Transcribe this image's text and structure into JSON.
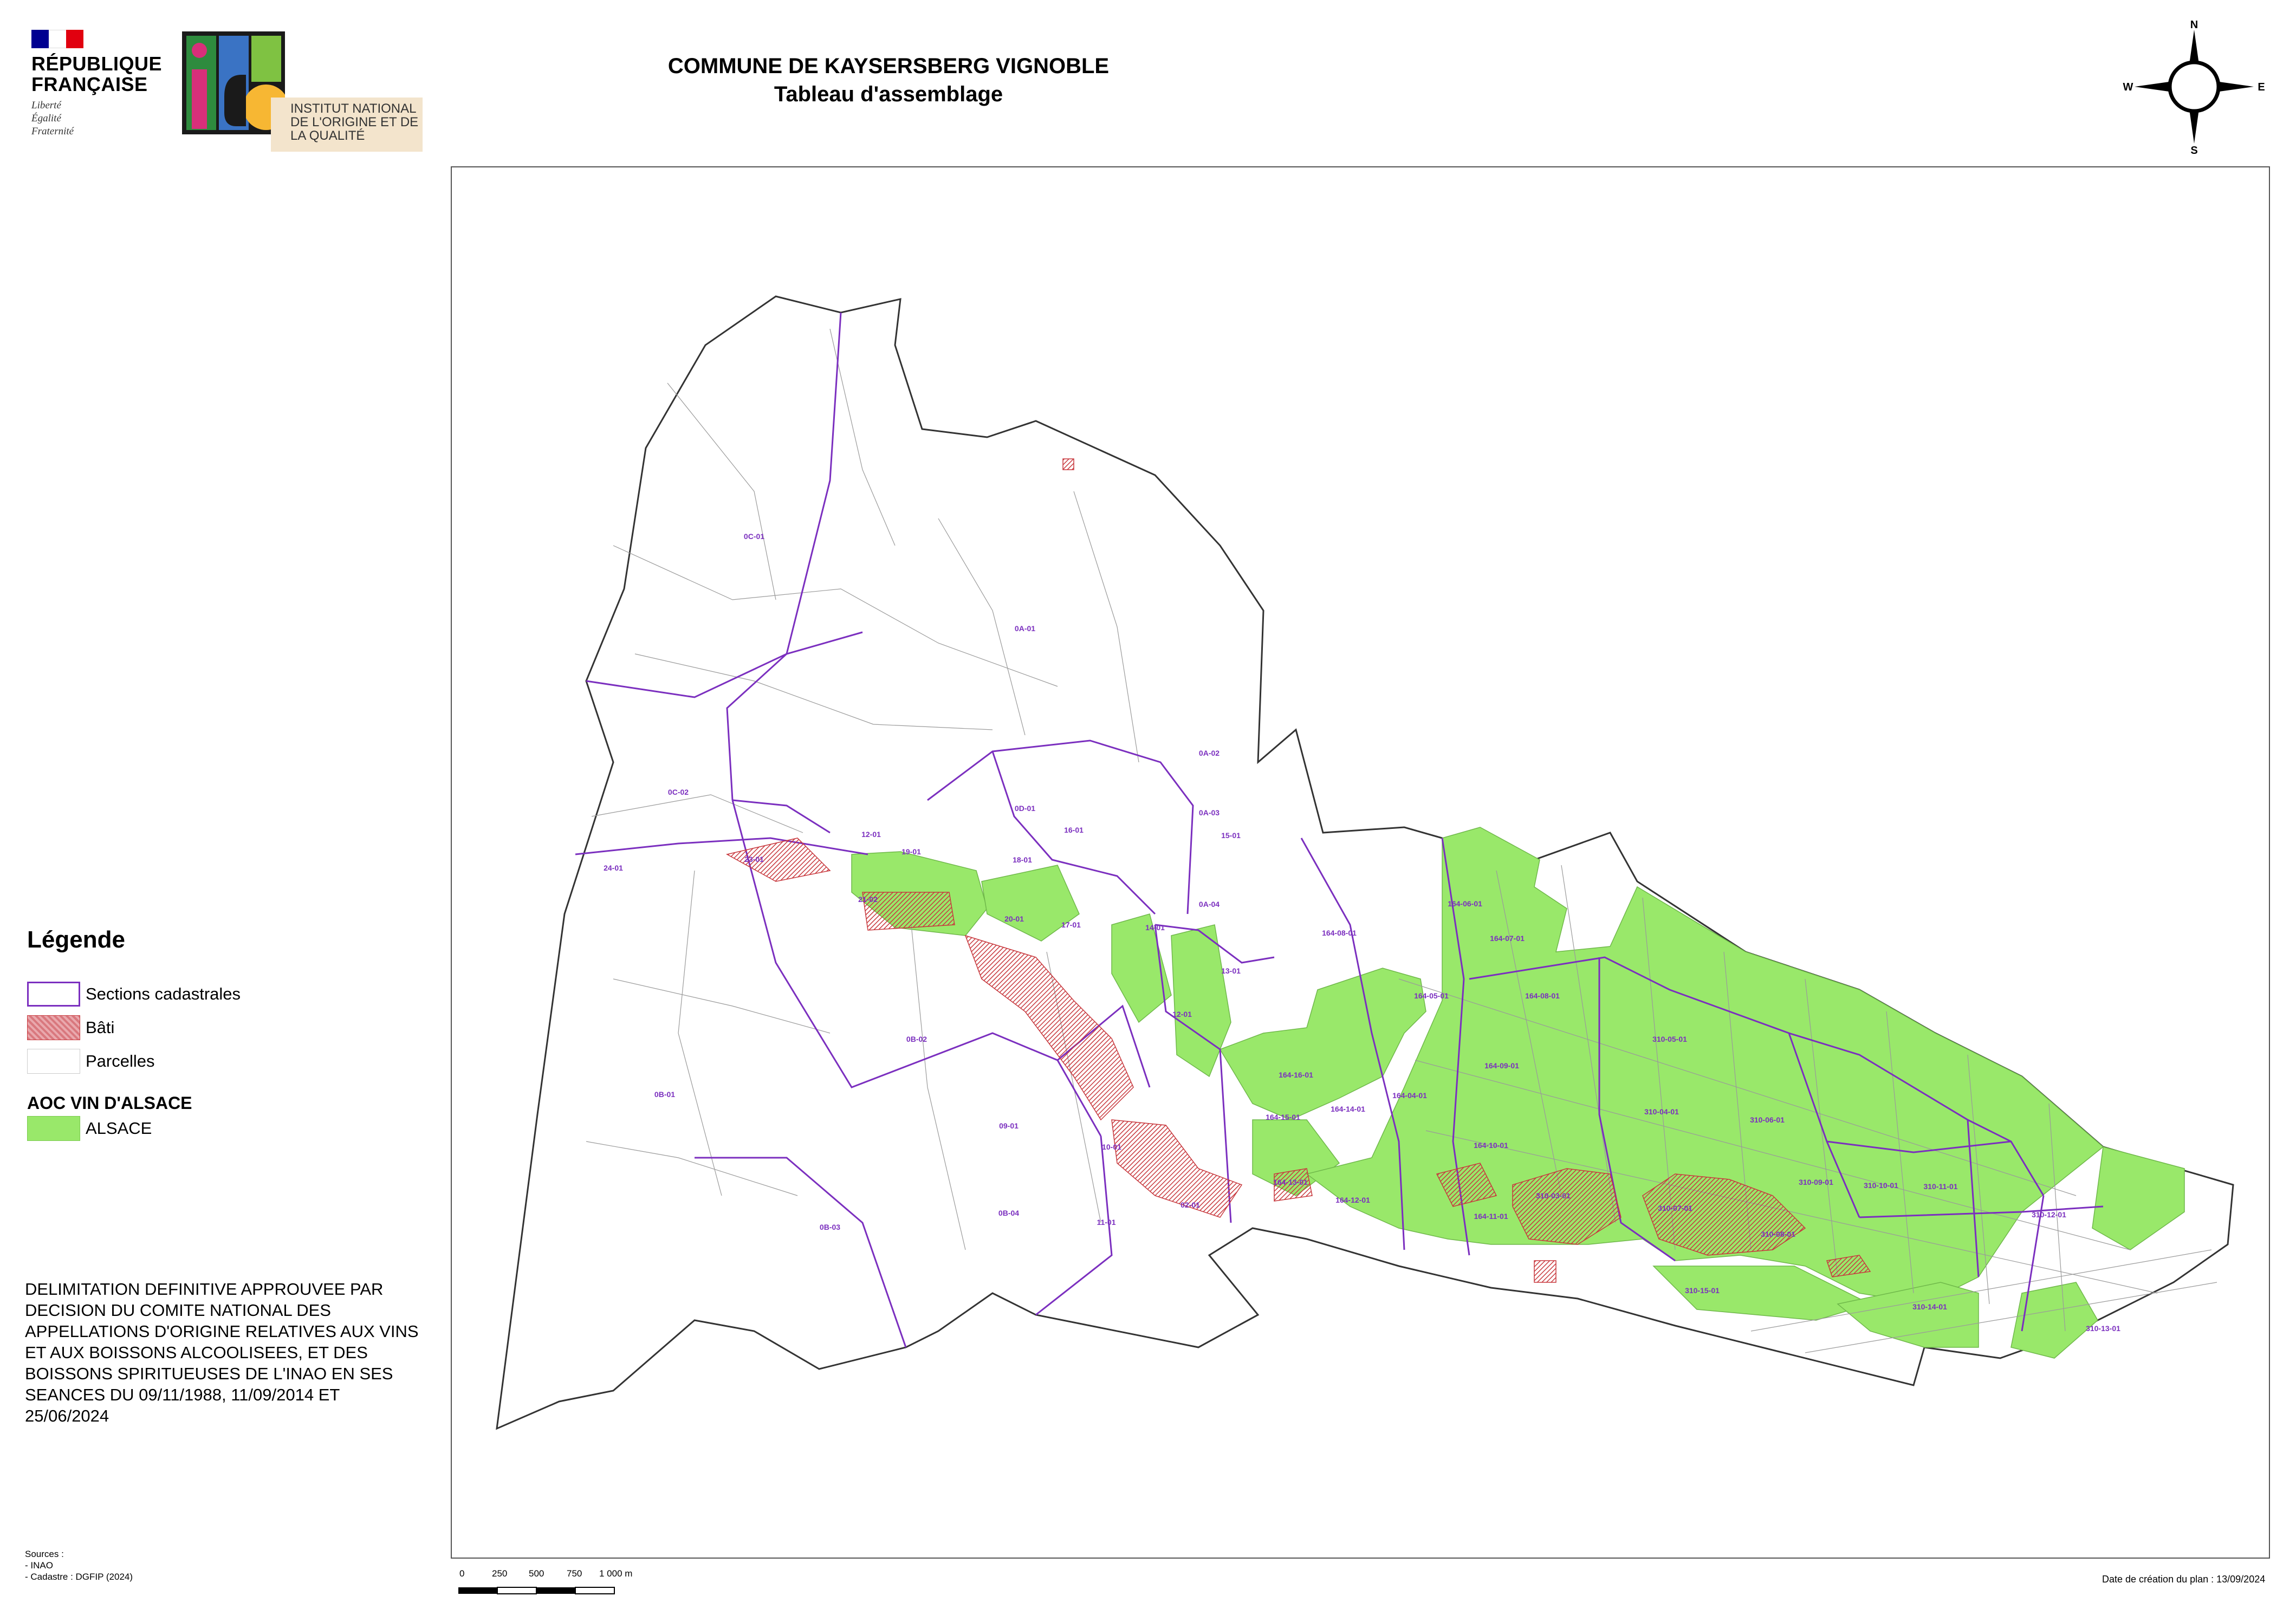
{
  "header": {
    "republique": "RÉPUBLIQUE\nFRANÇAISE",
    "republique_line1": "RÉPUBLIQUE",
    "republique_line2": "FRANÇAISE",
    "motto": "Liberté\nÉgalité\nFraternité",
    "inao_name": "INSTITUT NATIONAL\nDE L'ORIGINE ET DE\nLA QUALITÉ",
    "title": "COMMUNE DE KAYSERSBERG VIGNOBLE",
    "subtitle": "Tableau d'assemblage"
  },
  "compass": {
    "n": "N",
    "s": "S",
    "e": "E",
    "w": "W"
  },
  "legend": {
    "title": "Légende",
    "items": [
      {
        "label": "Sections cadastrales",
        "color": "#7b2fbf"
      },
      {
        "label": "Bâti",
        "color": "#d9787e"
      },
      {
        "label": "Parcelles",
        "color": "#ffffff"
      }
    ],
    "aoc_title": "AOC VIN D'ALSACE",
    "aoc_items": [
      {
        "label": "ALSACE",
        "color": "#99e86a"
      }
    ]
  },
  "decision_text": "DELIMITATION DEFINITIVE APPROUVEE PAR\nDECISION DU COMITE NATIONAL DES\nAPPELLATIONS D'ORIGINE RELATIVES AUX VINS\nET AUX BOISSONS ALCOOLISEES, ET DES\nBOISSONS SPIRITUEUSES DE L'INAO EN SES\nSEANCES DU 09/11/1988, 11/09/2014 ET\n25/06/2024",
  "sources": "Sources :\n- INAO\n- Cadastre : DGFIP (2024)",
  "scale": {
    "ticks": [
      "0",
      "250",
      "500",
      "750",
      "1 000 m"
    ]
  },
  "date_text": "Date de création du plan : 13/09/2024",
  "sections": [
    "0C-01",
    "0A-01",
    "0A-02",
    "0C-02",
    "0D-01",
    "0A-03",
    "0A-04",
    "12-01",
    "16-01",
    "15-01",
    "19-01",
    "18-01",
    "24-01",
    "23-01",
    "21-02",
    "20-01",
    "17-01",
    "14-01",
    "13-01",
    "12-01",
    "0B-02",
    "0B-01",
    "09-01",
    "10-01",
    "0B-03",
    "0B-04",
    "11-01",
    "02-01",
    "164-08-01",
    "164-06-01",
    "164-07-01",
    "164-05-01",
    "164-08-01",
    "164-16-01",
    "164-15-01",
    "164-14-01",
    "164-04-01",
    "164-09-01",
    "164-10-01",
    "164-13-01",
    "164-12-01",
    "164-11-01",
    "310-05-01",
    "310-04-01",
    "310-06-01",
    "310-09-01",
    "310-10-01",
    "310-11-01",
    "310-12-01",
    "310-08-01",
    "310-07-01",
    "310-15-01",
    "310-14-01",
    "310-13-01",
    "310-03-01"
  ],
  "colors": {
    "section": "#7b2fbf",
    "bati": "#c8393e",
    "aoc": "#99e86a",
    "parcel_line": "#9a9a9a"
  }
}
